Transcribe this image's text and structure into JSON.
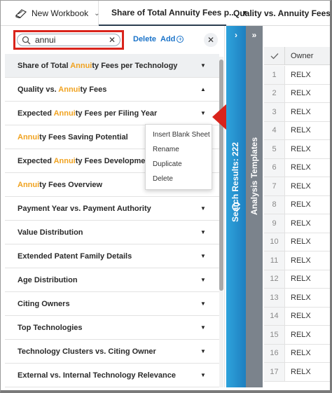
{
  "topbar": {
    "workbook_label": "New Workbook",
    "active_tab": "Share of Total Annuity Fees p...",
    "second_tab": "Quality vs. Annuity Fees"
  },
  "search": {
    "value": "annui",
    "delete_label": "Delete",
    "add_label": "Add"
  },
  "list": {
    "items": [
      {
        "pre": "Share of Total ",
        "hl": "Annui",
        "post": "ty Fees per Technology",
        "caret": "▼"
      },
      {
        "pre": "Quality vs. ",
        "hl": "Annui",
        "post": "ty Fees",
        "caret": "▲"
      },
      {
        "pre": "Expected ",
        "hl": "Annui",
        "post": "ty Fees per Filing Year",
        "caret": "▼"
      },
      {
        "pre": "",
        "hl": "Annui",
        "post": "ty Fees Saving Potential",
        "caret": "▼"
      },
      {
        "pre": "Expected ",
        "hl": "Annui",
        "post": "ty Fees Development",
        "caret": "▼"
      },
      {
        "pre": "",
        "hl": "Annui",
        "post": "ty Fees Overview",
        "caret": "▼"
      },
      {
        "pre": "Payment Year vs. Payment Authority",
        "hl": "",
        "post": "",
        "caret": "▼"
      },
      {
        "pre": "Value Distribution",
        "hl": "",
        "post": "",
        "caret": "▼"
      },
      {
        "pre": "Extended Patent Family Details",
        "hl": "",
        "post": "",
        "caret": "▼"
      },
      {
        "pre": "Age Distribution",
        "hl": "",
        "post": "",
        "caret": "▼"
      },
      {
        "pre": "Citing Owners",
        "hl": "",
        "post": "",
        "caret": "▼"
      },
      {
        "pre": "Top Technologies",
        "hl": "",
        "post": "",
        "caret": "▼"
      },
      {
        "pre": "Technology Clusters vs. Citing Owner",
        "hl": "",
        "post": "",
        "caret": "▼"
      },
      {
        "pre": "External vs. Internal Technology Relevance",
        "hl": "",
        "post": "",
        "caret": "▼"
      }
    ]
  },
  "context_menu": {
    "items": [
      "Insert Blank Sheet",
      "Rename",
      "Duplicate",
      "Delete"
    ]
  },
  "side_strips": {
    "search_results": "Search Results: 222",
    "analysis_templates": "Analysis Templates"
  },
  "table": {
    "header": "Owner",
    "rows": [
      {
        "n": "1",
        "v": "RELX"
      },
      {
        "n": "2",
        "v": "RELX"
      },
      {
        "n": "3",
        "v": "RELX"
      },
      {
        "n": "4",
        "v": "RELX"
      },
      {
        "n": "5",
        "v": "RELX"
      },
      {
        "n": "6",
        "v": "RELX"
      },
      {
        "n": "7",
        "v": "RELX"
      },
      {
        "n": "8",
        "v": "RELX"
      },
      {
        "n": "9",
        "v": "RELX"
      },
      {
        "n": "10",
        "v": "RELX"
      },
      {
        "n": "11",
        "v": "RELX"
      },
      {
        "n": "12",
        "v": "RELX"
      },
      {
        "n": "13",
        "v": "RELX"
      },
      {
        "n": "14",
        "v": "RELX"
      },
      {
        "n": "15",
        "v": "RELX"
      },
      {
        "n": "16",
        "v": "RELX"
      },
      {
        "n": "17",
        "v": "RELX"
      }
    ]
  },
  "colors": {
    "highlight": "#f0a21f",
    "link": "#1a73c9",
    "annotation_red": "#d9241c",
    "strip_blue": "#2ea3dc",
    "strip_grey": "#7b838c"
  }
}
